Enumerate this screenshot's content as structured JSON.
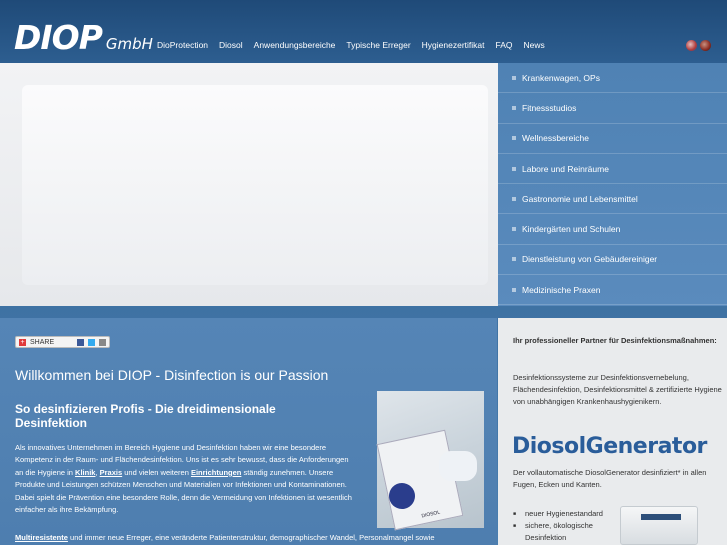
{
  "header": {
    "logo_big": "DIOP",
    "logo_small": "GmbH",
    "nav": [
      "DioProtection",
      "Diosol",
      "Anwendungsbereiche",
      "Typische Erreger",
      "Hygienezertifikat",
      "FAQ",
      "News"
    ]
  },
  "side_menu": {
    "items": [
      "Krankenwagen, OPs",
      "Fitnessstudios",
      "Wellnessbereiche",
      "Labore und Reinräume",
      "Gastronomie und Lebensmittel",
      "Kindergärten und Schulen",
      "Dienstleistung von Gebäudereiniger",
      "Medizinische Praxen"
    ]
  },
  "content": {
    "share_label": "SHARE",
    "welcome": "Willkommen bei DIOP - Disinfection is our Passion",
    "subhead": "So desinfizieren Profis - Die dreidimensionale Desinfektion",
    "p1_a": "Als innovatives Unternehmen im Bereich Hygiene und Desinfektion haben wir eine besondere Kompetenz in der Raum- und Flächendesinfektion. Uns ist es sehr bewusst, dass die Anforderungen an die Hygiene in ",
    "p1_link1": "Klinik",
    "p1_b": ", ",
    "p1_link2": "Praxis",
    "p1_c": " und vielen weiteren ",
    "p1_link3": "Einrichtungen",
    "p1_d": " ständig zunehmen. Unsere Produkte und Leistungen schützen Menschen und Materialien vor Infektionen und Kontaminationen. Dabei spielt die Prävention eine besondere Rolle, denn die Vermeidung von Infektionen ist wesentlich einfacher als ihre Bekämpfung.",
    "p2_link": "Multiresistente",
    "p2_rest": " und immer neue Erreger, eine veränderte Patientenstruktur, demographischer Wandel, Personalmangel sowie",
    "photo_label": "DIOSOL"
  },
  "right_panel": {
    "title": "Ihr professioneller Partner für Desinfektionsmaßnahmen:",
    "desc": "Desinfektionssysteme zur Desinfektionsvernebelung, Flächendesinfektion, Desinfektionsmittel & zertifizierte Hygiene von unabhängigen Krankenhaushygienikern.",
    "logo": "DiosolGenerator",
    "logo_desc": "Der vollautomatische DiosolGenerator desinfiziert* in allen Fugen, Ecken und Kanten.",
    "list": [
      "neuer Hygienestandard",
      "sichere, ökologische Desinfektion"
    ]
  }
}
